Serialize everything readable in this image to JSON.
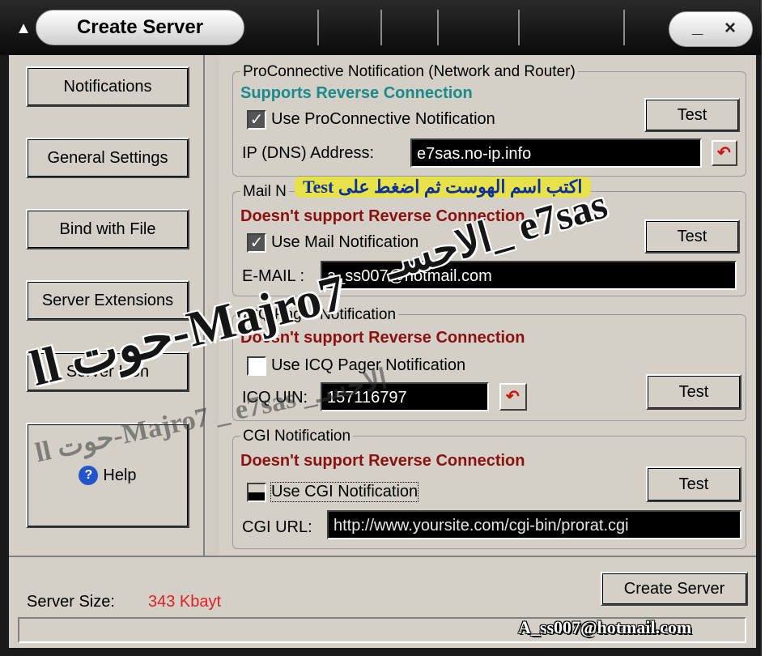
{
  "window": {
    "title": "Create Server",
    "minimize": "_",
    "close": "×"
  },
  "sidebar": {
    "items": [
      {
        "label": "Notifications"
      },
      {
        "label": "General Settings"
      },
      {
        "label": "Bind with File"
      },
      {
        "label": "Server Extensions"
      },
      {
        "label": "Server Icon"
      }
    ],
    "help_label": "Help"
  },
  "proconnective": {
    "title": "ProConnective Notification (Network and Router)",
    "support": "Supports Reverse Connection",
    "checkbox_label": "Use ProConnective Notification",
    "checked": true,
    "test_label": "Test",
    "field_label": "IP (DNS) Address:",
    "field_value": "e7sas.no-ip.info"
  },
  "mail": {
    "title": "Mail N",
    "support": "Doesn't support Reverse Connection",
    "checkbox_label": "Use Mail Notification",
    "checked": true,
    "test_label": "Test",
    "field_label": "E-MAIL :",
    "field_value": "a_ss007@hotmail.com"
  },
  "icq": {
    "title": "ICQ Pager Notification",
    "support": "Doesn't support Reverse Connection",
    "checkbox_label": "Use ICQ Pager Notification",
    "checked": false,
    "test_label": "Test",
    "field_label": "ICQ UIN:",
    "field_value": "157116797"
  },
  "cgi": {
    "title": "CGI Notification",
    "support": "Doesn't support Reverse Connection",
    "checkbox_label": "Use CGI Notification",
    "checked": false,
    "test_label": "Test",
    "field_label": "CGI URL:",
    "field_value": "http://www.yoursite.com/cgi-bin/prorat.cgi"
  },
  "footer": {
    "size_label": "Server Size:",
    "size_value": "343 Kbayt",
    "create_label": "Create Server"
  },
  "overlays": {
    "arabic_hint": "اكتب اسم الهوست ثم اضغط على Test",
    "watermark1": "ll حوت-Majro7",
    "watermark2": "e7sas _الاحسـ",
    "watermark3": "ll حوت-Majro7 _ e7sas _الاحسـ",
    "email_stamp": "A_ss007@hotmail.com"
  },
  "colors": {
    "teal": "#1a8a8a",
    "dark_red": "#8b1010",
    "size_red": "#e02020"
  }
}
